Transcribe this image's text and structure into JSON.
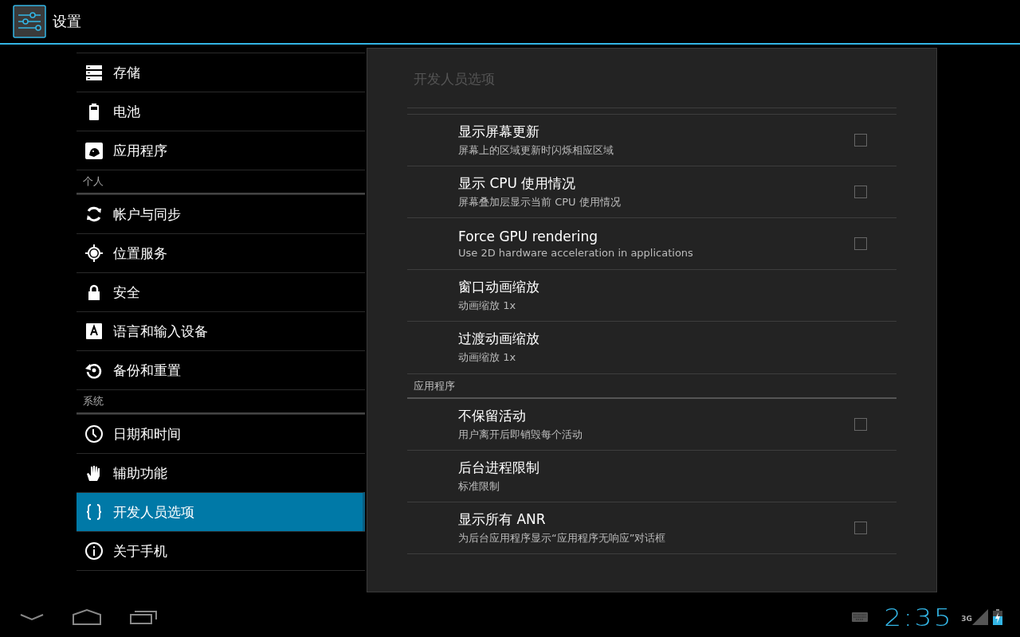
{
  "action_bar": {
    "title": "设置"
  },
  "sidebar": {
    "items": [
      {
        "kind": "item",
        "label": "存储",
        "selected": false
      },
      {
        "kind": "item",
        "label": "电池",
        "selected": false
      },
      {
        "kind": "item",
        "label": "应用程序",
        "selected": false
      },
      {
        "kind": "header",
        "label": "个人"
      },
      {
        "kind": "item",
        "label": "帐户与同步",
        "selected": false
      },
      {
        "kind": "item",
        "label": "位置服务",
        "selected": false
      },
      {
        "kind": "item",
        "label": "安全",
        "selected": false
      },
      {
        "kind": "item",
        "label": "语言和输入设备",
        "selected": false
      },
      {
        "kind": "item",
        "label": "备份和重置",
        "selected": false
      },
      {
        "kind": "header",
        "label": "系统"
      },
      {
        "kind": "item",
        "label": "日期和时间",
        "selected": false
      },
      {
        "kind": "item",
        "label": "辅助功能",
        "selected": false
      },
      {
        "kind": "item",
        "label": "开发人员选项",
        "selected": true
      },
      {
        "kind": "item",
        "label": "关于手机",
        "selected": false
      }
    ]
  },
  "panel": {
    "title": "开发人员选项",
    "items": [
      {
        "kind": "checkbox",
        "title": "显示屏幕更新",
        "summary": "屏幕上的区域更新时闪烁相应区域",
        "checked": false
      },
      {
        "kind": "checkbox",
        "title": "显示 CPU 使用情况",
        "summary": "屏幕叠加层显示当前 CPU 使用情况",
        "checked": false
      },
      {
        "kind": "checkbox",
        "title": "Force GPU rendering",
        "summary": "Use 2D hardware acceleration in applications",
        "checked": false
      },
      {
        "kind": "plain",
        "title": "窗口动画缩放",
        "summary": "动画缩放 1x"
      },
      {
        "kind": "plain",
        "title": "过渡动画缩放",
        "summary": "动画缩放 1x"
      },
      {
        "kind": "category",
        "title": "应用程序"
      },
      {
        "kind": "checkbox",
        "title": "不保留活动",
        "summary": "用户离开后即销毁每个活动",
        "checked": false
      },
      {
        "kind": "plain",
        "title": "后台进程限制",
        "summary": "标准限制"
      },
      {
        "kind": "checkbox",
        "title": "显示所有 ANR",
        "summary": "为后台应用程序显示“应用程序无响应”对话框",
        "checked": false
      }
    ]
  },
  "status_bar": {
    "time": "2:35",
    "network": "3G"
  }
}
